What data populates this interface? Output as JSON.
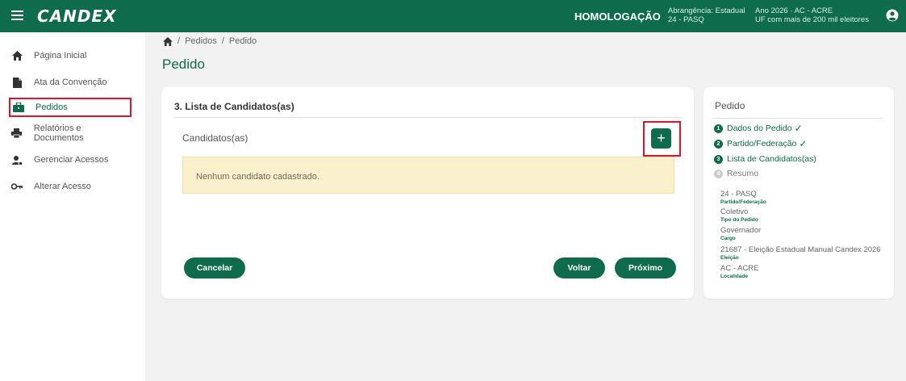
{
  "header": {
    "brand": "CANDEX",
    "environment": "HOMOLOGAÇÃO",
    "scope_line1": "Abrangência: Estadual",
    "scope_line2": "24 - PASQ",
    "year_line1": "Ano 2026 · AC - ACRE",
    "year_line2": "UF com mais de 200 mil eleitores"
  },
  "sidebar": {
    "items": [
      {
        "label": "Página Inicial",
        "icon": "home-icon"
      },
      {
        "label": "Ata da Convenção",
        "icon": "document-icon"
      },
      {
        "label": "Pedidos",
        "icon": "briefcase-icon"
      },
      {
        "label": "Relatórios e Documentos",
        "icon": "print-icon"
      },
      {
        "label": "Gerenciar Acessos",
        "icon": "users-gear-icon"
      },
      {
        "label": "Alterar Acesso",
        "icon": "key-icon"
      }
    ]
  },
  "breadcrumb": {
    "sep": "/",
    "level1": "Pedidos",
    "level2": "Pedido"
  },
  "page_title": "Pedido",
  "card": {
    "title": "3. Lista de Candidatos(as)",
    "subtitle": "Candidatos(as)",
    "add_label": "+",
    "empty_message": "Nenhum candidato cadastrado.",
    "cancel_label": "Cancelar",
    "back_label": "Voltar",
    "next_label": "Próximo"
  },
  "panel": {
    "title": "Pedido",
    "steps": [
      {
        "num": "1",
        "label": "Dados do Pedido",
        "check": "✓"
      },
      {
        "num": "2",
        "label": "Partido/Federação",
        "check": "✓"
      },
      {
        "num": "3",
        "label": "Lista de Candidatos(as)",
        "check": ""
      },
      {
        "num": "4",
        "label": "Resumo",
        "check": ""
      }
    ],
    "info": [
      {
        "value": "24 - PASQ",
        "key": "Partido/Federação"
      },
      {
        "value": "Coletivo",
        "key": "Tipo do Pedido"
      },
      {
        "value": "Governador",
        "key": "Cargo"
      },
      {
        "value": "21687 - Eleição Estadual Manual Candex 2026",
        "key": "Eleição"
      },
      {
        "value": "AC - ACRE",
        "key": "Localidade"
      }
    ]
  },
  "colors": {
    "primary": "#0e6b4c",
    "highlight": "#e3122a",
    "alert_bg": "#fbf0cc"
  }
}
